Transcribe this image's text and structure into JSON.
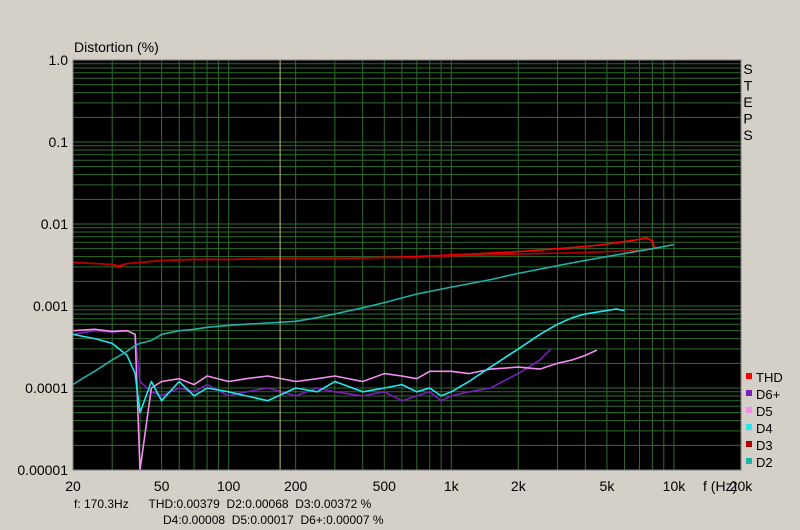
{
  "chart_data": {
    "type": "line",
    "title": "",
    "ylabel": "Distortion (%)",
    "xlabel": "f (Hz)",
    "x_scale": "log",
    "y_scale": "log",
    "xlim": [
      20,
      20000
    ],
    "ylim": [
      1e-05,
      1.0
    ],
    "grid": true,
    "background": "#000000",
    "grid_color": "#2f6b2f",
    "side_label": "STEPS",
    "x_ticks": [
      {
        "value": 20,
        "label": "20"
      },
      {
        "value": 50,
        "label": "50"
      },
      {
        "value": 100,
        "label": "100"
      },
      {
        "value": 200,
        "label": "200"
      },
      {
        "value": 500,
        "label": "500"
      },
      {
        "value": 1000,
        "label": "1k"
      },
      {
        "value": 2000,
        "label": "2k"
      },
      {
        "value": 5000,
        "label": "5k"
      },
      {
        "value": 10000,
        "label": "10k"
      },
      {
        "value": 20000,
        "label": "20k"
      }
    ],
    "y_ticks": [
      {
        "value": 1.0,
        "label": "1.0"
      },
      {
        "value": 0.1,
        "label": "0.1"
      },
      {
        "value": 0.01,
        "label": "0.01"
      },
      {
        "value": 0.001,
        "label": "0.001"
      },
      {
        "value": 0.0001,
        "label": "0.0001"
      },
      {
        "value": 1e-05,
        "label": "0.00001"
      }
    ],
    "cursor": {
      "x": 170.3,
      "color": "#c8b878"
    },
    "legend_position": "right",
    "series": [
      {
        "name": "THD",
        "color": "#ff0000",
        "x": [
          20,
          25,
          30,
          32,
          35,
          40,
          50,
          70,
          100,
          150,
          200,
          300,
          500,
          700,
          1000,
          1500,
          2000,
          3000,
          4000,
          5000,
          6000,
          7000,
          7500,
          8000,
          8200
        ],
        "y": [
          0.0034,
          0.0033,
          0.0032,
          0.003,
          0.0033,
          0.0034,
          0.0036,
          0.0037,
          0.0037,
          0.0038,
          0.0038,
          0.0038,
          0.0039,
          0.004,
          0.0042,
          0.0044,
          0.0046,
          0.005,
          0.0053,
          0.0057,
          0.0061,
          0.0065,
          0.0068,
          0.0062,
          0.005
        ]
      },
      {
        "name": "D6+",
        "color": "#7a1fb8",
        "x": [
          20,
          25,
          30,
          35,
          38,
          40,
          45,
          50,
          60,
          70,
          80,
          100,
          120,
          150,
          200,
          250,
          300,
          400,
          500,
          600,
          700,
          800,
          900,
          1000,
          1200,
          1500,
          1800,
          2000,
          2500,
          2800
        ],
        "y": [
          0.00045,
          0.0005,
          0.00048,
          0.0005,
          0.00045,
          0.00012,
          9e-05,
          8e-05,
          0.0001,
          9e-05,
          0.00011,
          8e-05,
          9e-05,
          0.0001,
          8e-05,
          0.0001,
          9e-05,
          8e-05,
          9e-05,
          7e-05,
          8e-05,
          9e-05,
          7e-05,
          8e-05,
          9e-05,
          0.0001,
          0.00013,
          0.00015,
          0.00022,
          0.0003
        ]
      },
      {
        "name": "D5",
        "color": "#f28ef0",
        "x": [
          20,
          25,
          30,
          35,
          38,
          40,
          45,
          50,
          60,
          70,
          80,
          100,
          120,
          150,
          200,
          250,
          300,
          400,
          500,
          600,
          700,
          800,
          1000,
          1200,
          1500,
          2000,
          2500,
          3000,
          3500,
          4000,
          4500
        ],
        "y": [
          0.0005,
          0.00052,
          0.00049,
          0.0005,
          0.00045,
          1e-05,
          0.0001,
          0.00012,
          0.00013,
          0.00011,
          0.00014,
          0.00012,
          0.00013,
          0.00014,
          0.00012,
          0.00013,
          0.00014,
          0.00012,
          0.00015,
          0.00014,
          0.00013,
          0.00016,
          0.00016,
          0.00015,
          0.00017,
          0.00018,
          0.00017,
          0.0002,
          0.00022,
          0.00025,
          0.00029
        ]
      },
      {
        "name": "D4",
        "color": "#22e6f0",
        "x": [
          20,
          25,
          30,
          35,
          38,
          40,
          45,
          50,
          60,
          70,
          80,
          100,
          120,
          150,
          200,
          250,
          300,
          400,
          500,
          600,
          700,
          800,
          900,
          1000,
          1200,
          1500,
          2000,
          2500,
          3000,
          3500,
          4000,
          5000,
          5500,
          6000
        ],
        "y": [
          0.00045,
          0.0004,
          0.00035,
          0.00025,
          0.00015,
          5e-05,
          0.00012,
          7e-05,
          0.00012,
          8e-05,
          0.0001,
          9e-05,
          8e-05,
          7e-05,
          0.0001,
          9e-05,
          0.00012,
          9e-05,
          0.0001,
          0.00011,
          9e-05,
          0.0001,
          8e-05,
          9e-05,
          0.00012,
          0.00018,
          0.0003,
          0.00045,
          0.0006,
          0.00072,
          0.0008,
          0.00088,
          0.00092,
          0.00088
        ]
      },
      {
        "name": "D3",
        "color": "#b30000",
        "x": [
          20,
          25,
          30,
          32,
          35,
          40,
          50,
          70,
          100,
          150,
          200,
          300,
          500,
          700,
          1000,
          1500,
          2000,
          3000,
          4000,
          5000,
          6000,
          7000,
          7500,
          8000
        ],
        "y": [
          0.0034,
          0.0033,
          0.0032,
          0.0031,
          0.0033,
          0.0034,
          0.0036,
          0.0037,
          0.0037,
          0.0038,
          0.0038,
          0.0038,
          0.0039,
          0.0039,
          0.0041,
          0.0042,
          0.0043,
          0.0044,
          0.0045,
          0.0046,
          0.0047,
          0.0048,
          0.0049,
          0.005
        ]
      },
      {
        "name": "D2",
        "color": "#1fb0a8",
        "x": [
          20,
          22,
          25,
          30,
          35,
          38,
          40,
          45,
          50,
          60,
          70,
          80,
          100,
          120,
          150,
          200,
          250,
          300,
          400,
          500,
          700,
          1000,
          1500,
          2000,
          3000,
          4000,
          5000,
          7000,
          8000,
          10000
        ],
        "y": [
          0.00011,
          0.00013,
          0.00016,
          0.00022,
          0.00028,
          0.00033,
          0.00035,
          0.00038,
          0.00045,
          0.0005,
          0.00052,
          0.00055,
          0.00058,
          0.0006,
          0.00062,
          0.00065,
          0.00072,
          0.0008,
          0.00095,
          0.0011,
          0.0014,
          0.0017,
          0.0021,
          0.0025,
          0.0031,
          0.0036,
          0.004,
          0.0047,
          0.005,
          0.0056
        ]
      }
    ]
  },
  "readout": {
    "line1": "f: 170.3Hz      THD:0.00379  D2:0.00068  D3:0.00372 %",
    "line2": "D4:0.00008  D5:0.00017  D6+:0.00007 %"
  }
}
